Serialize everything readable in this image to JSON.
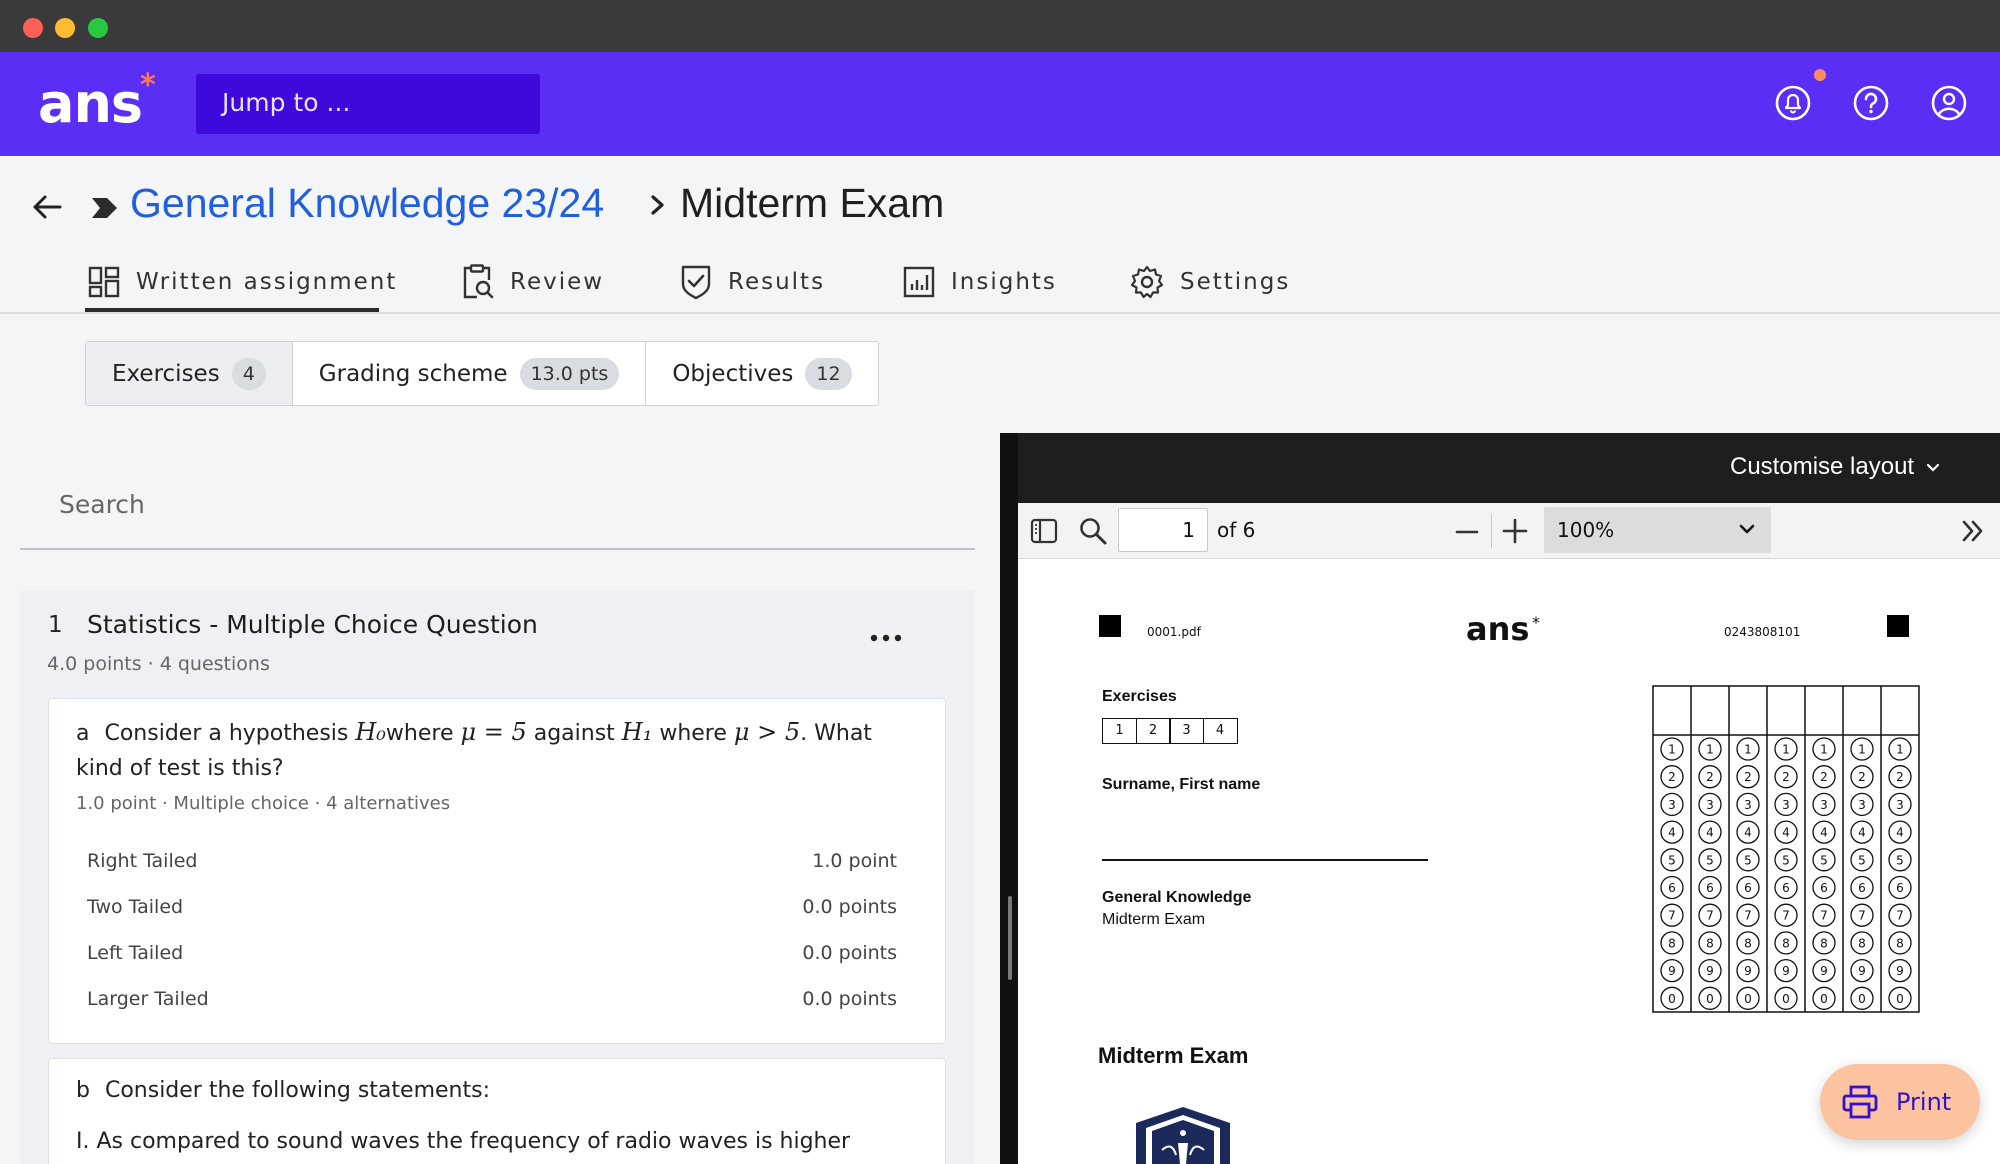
{
  "app": {
    "logo": "ans",
    "logo_star": "*",
    "jump_placeholder": "Jump to ..."
  },
  "breadcrumb": {
    "course": "General Knowledge 23/24",
    "page": "Midterm Exam"
  },
  "tabs": [
    {
      "label": "Written assignment",
      "icon": "grid-icon",
      "active": true
    },
    {
      "label": "Review",
      "icon": "clipboard-search-icon"
    },
    {
      "label": "Results",
      "icon": "shield-check-icon"
    },
    {
      "label": "Insights",
      "icon": "bar-chart-icon"
    },
    {
      "label": "Settings",
      "icon": "gear-icon"
    }
  ],
  "segments": [
    {
      "label": "Exercises",
      "badge": "4"
    },
    {
      "label": "Grading scheme",
      "badge": "13.0 pts"
    },
    {
      "label": "Objectives",
      "badge": "12"
    }
  ],
  "search": {
    "placeholder": "Search"
  },
  "exercise": {
    "number": "1",
    "title": "Statistics - Multiple Choice Question",
    "meta": "4.0 points · 4 questions",
    "questions": [
      {
        "letter": "a",
        "text_1": "Consider a hypothesis ",
        "math_1": "H₀",
        "text_2": "where ",
        "math_2": "μ = 5",
        "text_3": " against ",
        "math_3": "H₁",
        "text_4": " where ",
        "math_4": "μ > 5",
        "text_5": ". What kind of test is this?",
        "meta": "1.0 point · Multiple choice · 4 alternatives",
        "alternatives": [
          {
            "label": "Right Tailed",
            "points": "1.0 point"
          },
          {
            "label": "Two Tailed",
            "points": "0.0 points"
          },
          {
            "label": "Left Tailed",
            "points": "0.0 points"
          },
          {
            "label": "Larger Tailed",
            "points": "0.0 points"
          }
        ]
      },
      {
        "letter": "b",
        "text": "Consider the following statements:",
        "line_1": "I. As compared to sound waves the frequency of radio waves is higher"
      }
    ]
  },
  "viewer": {
    "customise": "Customise layout",
    "page_input": "1",
    "page_total": "of 6",
    "zoom": "100%",
    "pdf": {
      "file": "0001.pdf",
      "logo": "ans",
      "logo_star": "*",
      "id": "0243808101",
      "exercises_label": "Exercises",
      "exercise_boxes": [
        "1",
        "2",
        "3",
        "4"
      ],
      "name_label": "Surname, First name",
      "course": "General Knowledge",
      "exam": "Midterm Exam",
      "title": "Midterm Exam",
      "digits": [
        "1",
        "2",
        "3",
        "4",
        "5",
        "6",
        "7",
        "8",
        "9",
        "0"
      ]
    }
  },
  "print": {
    "label": "Print"
  },
  "colors": {
    "brand": "#5b2ef5",
    "accent": "#ff8a5b",
    "link": "#1f5fe0"
  }
}
